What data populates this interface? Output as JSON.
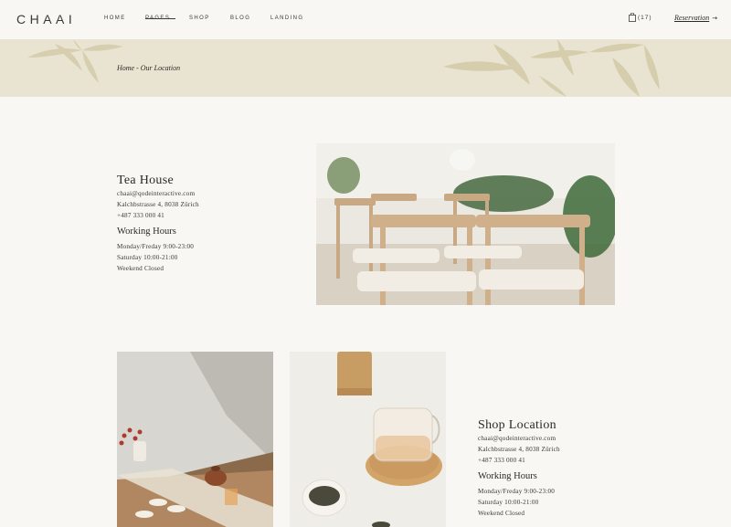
{
  "header": {
    "logo": "CHAAI",
    "nav": {
      "home": "HOME",
      "pages": "PAGES",
      "shop": "SHOP",
      "blog": "BLOG",
      "landing": "LANDING"
    },
    "cart_count": "(17)",
    "reservation": "Reservation"
  },
  "breadcrumb": "Home - Our Location",
  "locations": [
    {
      "title": "Tea House",
      "email": "chaai@qodeinteractive.com",
      "address": "Kalchbstrasse 4, 8038 Zürich",
      "phone": "+487 333 000 41",
      "hours_title": "Working Hours",
      "hours": [
        "Monday/Freday 9:00-23:00",
        "Saturday 10:00-21:00",
        "Weekend Closed"
      ]
    },
    {
      "title": "Shop Location",
      "email": "chaai@qodeinteractive.com",
      "address": "Kalchbstrasse 4, 8038 Zürich",
      "phone": "+487 333 000 41",
      "hours_title": "Working Hours",
      "hours": [
        "Monday/Freday 9:00-23:00",
        "Saturday 10:00-21:00",
        "Weekend Closed"
      ]
    }
  ],
  "icons": {
    "cart": "shopping-bag-icon",
    "reservation_arrow": "arrow-right-icon"
  }
}
